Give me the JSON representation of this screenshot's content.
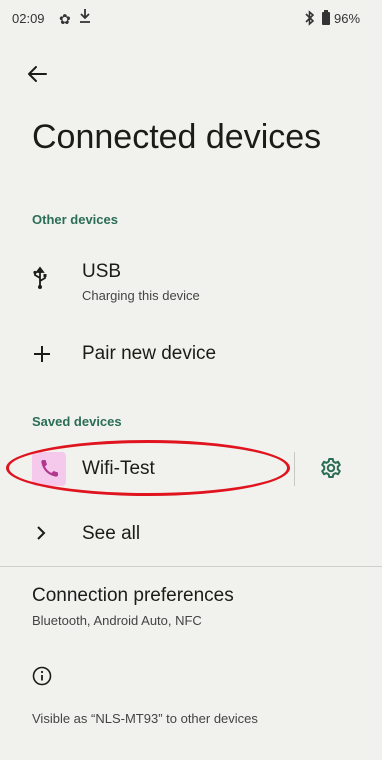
{
  "status_bar": {
    "time": "02:09",
    "battery_percent": "96%",
    "icons": [
      "gear-icon",
      "download-icon",
      "bluetooth-icon",
      "battery-icon"
    ]
  },
  "page": {
    "title": "Connected devices"
  },
  "other_devices": {
    "header": "Other devices",
    "usb": {
      "title": "USB",
      "subtitle": "Charging this device",
      "icon": "usb-icon"
    },
    "pair": {
      "title": "Pair new device",
      "icon": "plus-icon"
    }
  },
  "saved_devices": {
    "header": "Saved devices",
    "device": {
      "name": "Wifi-Test",
      "icon": "phone-icon",
      "settings_icon": "gear-icon"
    },
    "see_all": {
      "label": "See all",
      "icon": "chevron-right-icon"
    }
  },
  "connection_preferences": {
    "title": "Connection preferences",
    "subtitle": "Bluetooth, Android Auto, NFC"
  },
  "footer": {
    "icon": "info-icon",
    "visible_text": "Visible as “NLS-MT93” to other devices"
  },
  "colors": {
    "background": "#f1f2ee",
    "accent": "#2b6d55",
    "device_icon_bg": "#f4c9ec",
    "device_icon": "#b0388f",
    "highlight": "#e0141e"
  }
}
